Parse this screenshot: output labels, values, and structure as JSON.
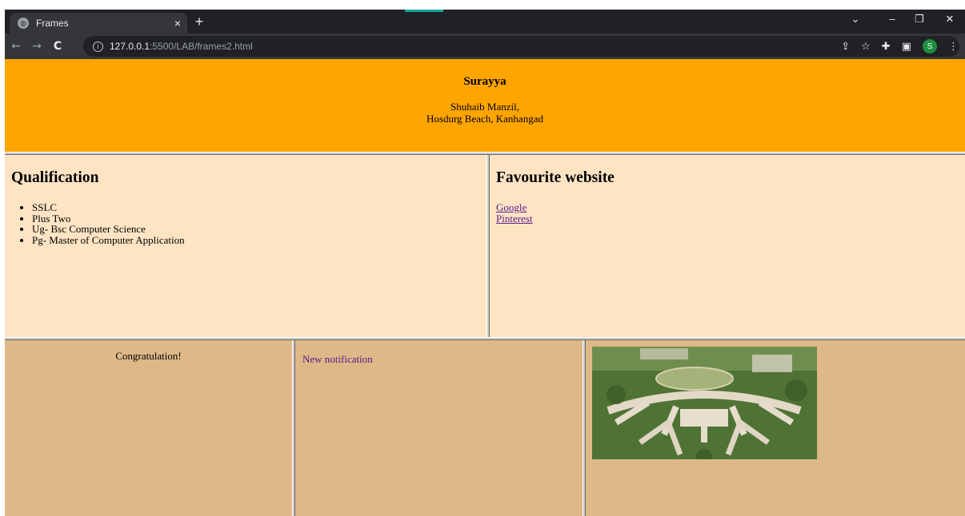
{
  "browser": {
    "tab_title": "Frames",
    "tab_close": "×",
    "new_tab": "+",
    "url_host": "127.0.0.1",
    "url_rest": ":5500/LAB/frames2.html",
    "profile_initial": "S",
    "controls": {
      "dropdown": "⌄",
      "minimize": "–",
      "restore": "❐",
      "close": "✕"
    },
    "icons": [
      "share-icon",
      "star-icon",
      "extensions-icon",
      "side-panel-icon",
      "menu-icon"
    ]
  },
  "header": {
    "name": "Surayya",
    "address_line1": "Shuhaib Manzil,",
    "address_line2": "Hosdurg Beach, Kanhangad"
  },
  "qualification": {
    "heading": "Qualification",
    "items": [
      "SSLC",
      "Plus Two",
      "Ug- Bsc Computer Science",
      "Pg- Master of Computer Application"
    ]
  },
  "websites": {
    "heading": "Favourite website",
    "links": [
      "Google",
      "Pinterest"
    ]
  },
  "bottom": {
    "congrats": "Congratulation!",
    "notification": "New notification"
  },
  "colors": {
    "header_bg": "#ffa500",
    "middle_bg": "#ffe4c4",
    "bottom_bg": "#deb887",
    "visited_link": "#551a8b"
  }
}
